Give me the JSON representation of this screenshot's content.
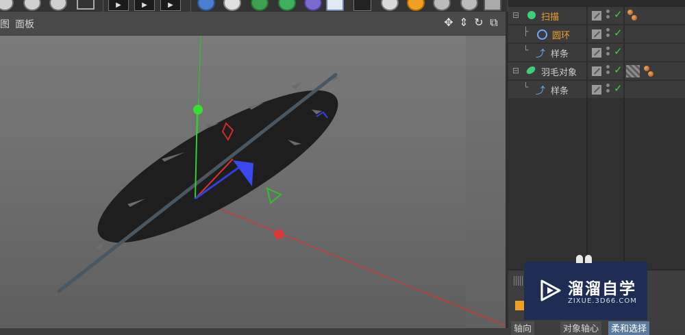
{
  "viewport_menu": {
    "item_left": "视图",
    "panel": "面板"
  },
  "object_manager": {
    "rows": [
      {
        "name": "扫描",
        "selected": true
      },
      {
        "name": "圆环",
        "selected": true
      },
      {
        "name": "样条",
        "selected": false
      },
      {
        "name": "羽毛对象",
        "selected": false
      },
      {
        "name": "样条",
        "selected": false
      }
    ]
  },
  "attribute_tabs": [
    "轴向",
    "对象轴心",
    "柔和选择"
  ],
  "watermark": {
    "title": "溜溜自学",
    "url": "ZIXUE.3D66.COM"
  },
  "colors": {
    "x_axis": "#e03030",
    "y_axis": "#30c030",
    "z_axis": "#3040e0",
    "selected_text": "#f0a030",
    "check": "#3fd04f"
  }
}
